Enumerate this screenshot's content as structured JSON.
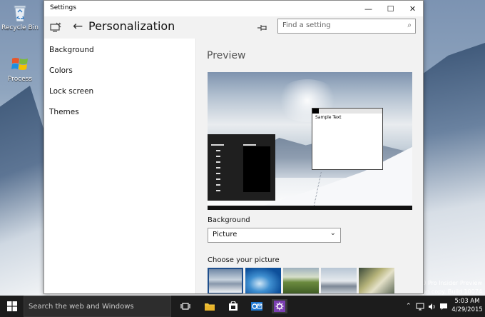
{
  "desktop": {
    "icons": [
      {
        "label": "Recycle Bin"
      },
      {
        "label": "Process"
      }
    ],
    "watermark": {
      "line1": "s 10 Pro Insider Preview",
      "line2": "valuation copy. Build 10074"
    }
  },
  "window": {
    "title": "Settings",
    "page_title": "Personalization",
    "search_placeholder": "Find a setting",
    "controls": {
      "minimize": "—",
      "maximize": "☐",
      "close": "✕"
    }
  },
  "sidebar": {
    "items": [
      {
        "label": "Background"
      },
      {
        "label": "Colors"
      },
      {
        "label": "Lock screen"
      },
      {
        "label": "Themes"
      }
    ]
  },
  "content": {
    "preview_heading": "Preview",
    "preview_sample_text": "Sample Text",
    "background_label": "Background",
    "background_value": "Picture",
    "choose_label": "Choose your picture"
  },
  "taskbar": {
    "search_placeholder": "Search the web and Windows",
    "time": "5:03 AM",
    "date": "4/29/2015"
  },
  "colors": {
    "accent": "#1e4e8c",
    "taskbar": "#1c1c1c",
    "onenote": "#7b3fb2"
  }
}
